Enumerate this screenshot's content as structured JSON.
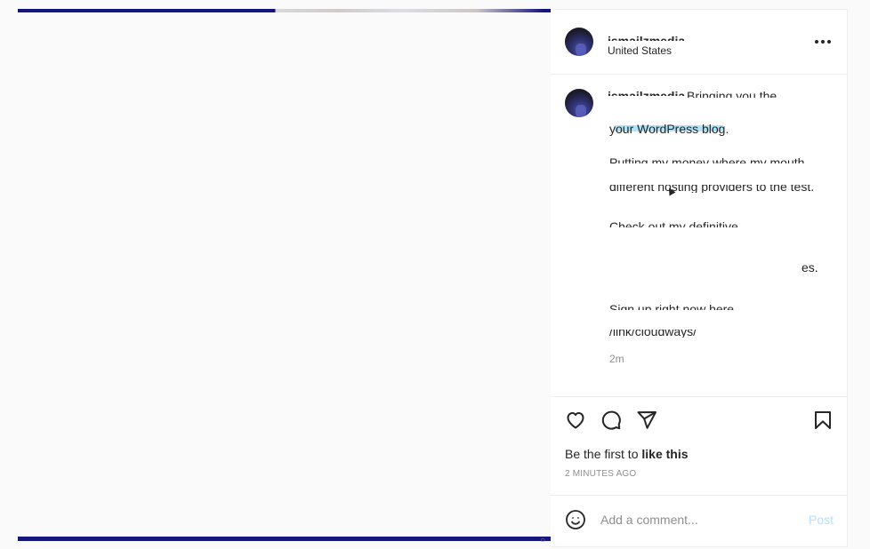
{
  "post": {
    "username": "ismailzmedia",
    "location": "United States"
  },
  "caption": {
    "username": "ismailzmedia",
    "lines": [
      "Bringing you the",
      "your WordPress blog.",
      "Putting my money where my mouth",
      "different hosting providers to the test.",
      "Check out my definitive",
      "es.",
      "Sign up right now here",
      "/link/cloudways/"
    ],
    "time_short": "2m"
  },
  "actions": {
    "likes_prefix": "Be the first to ",
    "likes_link": "like this",
    "time_posted": "2 MINUTES AGO"
  },
  "comment": {
    "placeholder": "Add a comment...",
    "post_label": "Post"
  },
  "icons": {
    "like": "heart-icon",
    "comment": "speech-bubble-icon",
    "share": "paper-plane-icon",
    "save": "bookmark-icon",
    "emoji": "smiley-icon",
    "more": "more-horizontal-icon"
  },
  "colors": {
    "media_bar": "#14147d",
    "text": "#262626",
    "muted": "#8e8e8e",
    "post_button_disabled": "#b2dffc",
    "caption_highlight": "#a8e0f7"
  }
}
